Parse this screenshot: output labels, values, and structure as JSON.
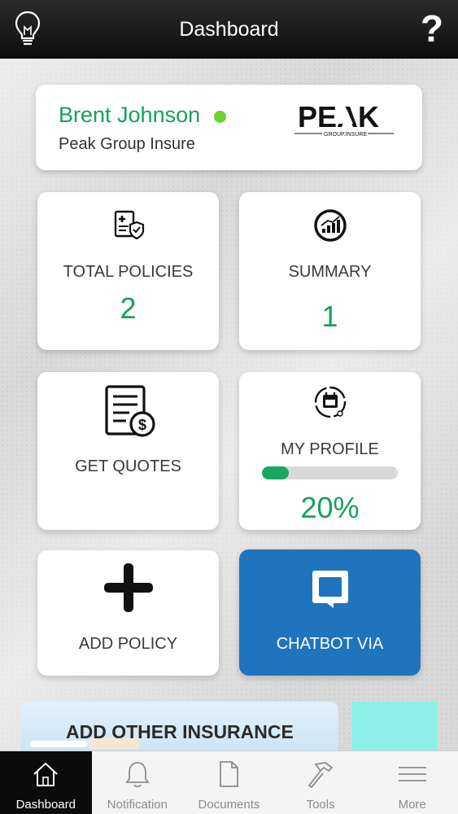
{
  "header": {
    "title": "Dashboard",
    "left_icon": "lightbulb-icon",
    "right_label": "?"
  },
  "user": {
    "name": "Brent Johnson",
    "status_color": "#6cd12a",
    "company": "Peak Group Insure",
    "logo_text": "PEAK",
    "logo_subtext": "GROUP.INSURE"
  },
  "tiles": {
    "total_policies": {
      "label": "TOTAL POLICIES",
      "value": "2",
      "icon": "policy-shield-icon"
    },
    "summary": {
      "label": "SUMMARY",
      "value": "1",
      "icon": "summary-chart-icon"
    },
    "get_quotes": {
      "label": "GET QUOTES",
      "icon": "quote-document-dollar-icon"
    },
    "my_profile": {
      "label": "MY PROFILE",
      "progress_percent": 20,
      "progress_text": "20%",
      "icon": "profile-calendar-icon"
    },
    "add_policy": {
      "label": "ADD POLICY",
      "icon": "plus-icon"
    },
    "chatbot": {
      "label": "CHATBOT VIA",
      "icon": "chat-bubble-icon",
      "color": "#1f74bd"
    }
  },
  "banner": {
    "label": "ADD OTHER INSURANCE"
  },
  "tabbar": {
    "items": [
      {
        "label": "Dashboard",
        "icon": "home-icon",
        "active": true
      },
      {
        "label": "Notification",
        "icon": "bell-icon"
      },
      {
        "label": "Documents",
        "icon": "document-icon"
      },
      {
        "label": "Tools",
        "icon": "hammer-icon"
      },
      {
        "label": "More",
        "icon": "menu-icon"
      }
    ]
  },
  "colors": {
    "accent_green": "#17a05d",
    "header_bg": "#1a1a1a"
  }
}
